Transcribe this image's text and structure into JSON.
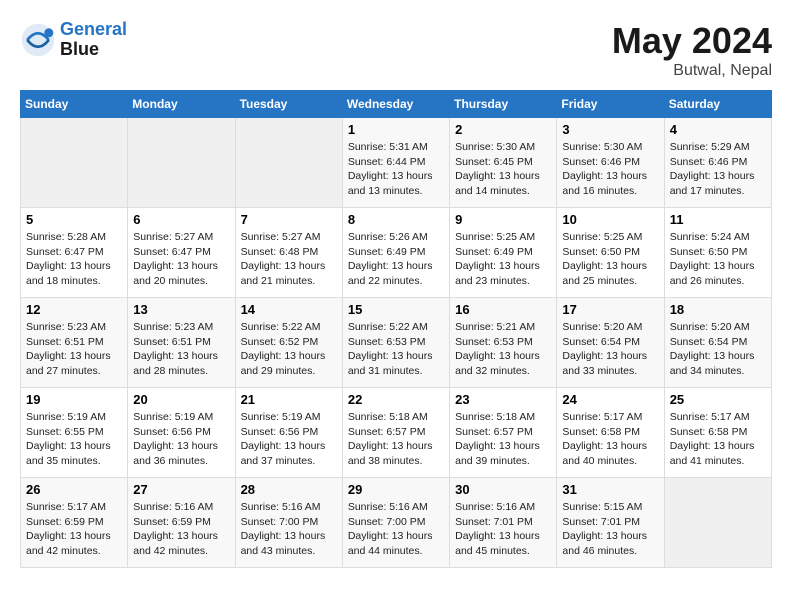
{
  "header": {
    "logo_line1": "General",
    "logo_line2": "Blue",
    "month_year": "May 2024",
    "location": "Butwal, Nepal"
  },
  "days_of_week": [
    "Sunday",
    "Monday",
    "Tuesday",
    "Wednesday",
    "Thursday",
    "Friday",
    "Saturday"
  ],
  "weeks": [
    [
      {
        "day": "",
        "info": ""
      },
      {
        "day": "",
        "info": ""
      },
      {
        "day": "",
        "info": ""
      },
      {
        "day": "1",
        "info": "Sunrise: 5:31 AM\nSunset: 6:44 PM\nDaylight: 13 hours\nand 13 minutes."
      },
      {
        "day": "2",
        "info": "Sunrise: 5:30 AM\nSunset: 6:45 PM\nDaylight: 13 hours\nand 14 minutes."
      },
      {
        "day": "3",
        "info": "Sunrise: 5:30 AM\nSunset: 6:46 PM\nDaylight: 13 hours\nand 16 minutes."
      },
      {
        "day": "4",
        "info": "Sunrise: 5:29 AM\nSunset: 6:46 PM\nDaylight: 13 hours\nand 17 minutes."
      }
    ],
    [
      {
        "day": "5",
        "info": "Sunrise: 5:28 AM\nSunset: 6:47 PM\nDaylight: 13 hours\nand 18 minutes."
      },
      {
        "day": "6",
        "info": "Sunrise: 5:27 AM\nSunset: 6:47 PM\nDaylight: 13 hours\nand 20 minutes."
      },
      {
        "day": "7",
        "info": "Sunrise: 5:27 AM\nSunset: 6:48 PM\nDaylight: 13 hours\nand 21 minutes."
      },
      {
        "day": "8",
        "info": "Sunrise: 5:26 AM\nSunset: 6:49 PM\nDaylight: 13 hours\nand 22 minutes."
      },
      {
        "day": "9",
        "info": "Sunrise: 5:25 AM\nSunset: 6:49 PM\nDaylight: 13 hours\nand 23 minutes."
      },
      {
        "day": "10",
        "info": "Sunrise: 5:25 AM\nSunset: 6:50 PM\nDaylight: 13 hours\nand 25 minutes."
      },
      {
        "day": "11",
        "info": "Sunrise: 5:24 AM\nSunset: 6:50 PM\nDaylight: 13 hours\nand 26 minutes."
      }
    ],
    [
      {
        "day": "12",
        "info": "Sunrise: 5:23 AM\nSunset: 6:51 PM\nDaylight: 13 hours\nand 27 minutes."
      },
      {
        "day": "13",
        "info": "Sunrise: 5:23 AM\nSunset: 6:51 PM\nDaylight: 13 hours\nand 28 minutes."
      },
      {
        "day": "14",
        "info": "Sunrise: 5:22 AM\nSunset: 6:52 PM\nDaylight: 13 hours\nand 29 minutes."
      },
      {
        "day": "15",
        "info": "Sunrise: 5:22 AM\nSunset: 6:53 PM\nDaylight: 13 hours\nand 31 minutes."
      },
      {
        "day": "16",
        "info": "Sunrise: 5:21 AM\nSunset: 6:53 PM\nDaylight: 13 hours\nand 32 minutes."
      },
      {
        "day": "17",
        "info": "Sunrise: 5:20 AM\nSunset: 6:54 PM\nDaylight: 13 hours\nand 33 minutes."
      },
      {
        "day": "18",
        "info": "Sunrise: 5:20 AM\nSunset: 6:54 PM\nDaylight: 13 hours\nand 34 minutes."
      }
    ],
    [
      {
        "day": "19",
        "info": "Sunrise: 5:19 AM\nSunset: 6:55 PM\nDaylight: 13 hours\nand 35 minutes."
      },
      {
        "day": "20",
        "info": "Sunrise: 5:19 AM\nSunset: 6:56 PM\nDaylight: 13 hours\nand 36 minutes."
      },
      {
        "day": "21",
        "info": "Sunrise: 5:19 AM\nSunset: 6:56 PM\nDaylight: 13 hours\nand 37 minutes."
      },
      {
        "day": "22",
        "info": "Sunrise: 5:18 AM\nSunset: 6:57 PM\nDaylight: 13 hours\nand 38 minutes."
      },
      {
        "day": "23",
        "info": "Sunrise: 5:18 AM\nSunset: 6:57 PM\nDaylight: 13 hours\nand 39 minutes."
      },
      {
        "day": "24",
        "info": "Sunrise: 5:17 AM\nSunset: 6:58 PM\nDaylight: 13 hours\nand 40 minutes."
      },
      {
        "day": "25",
        "info": "Sunrise: 5:17 AM\nSunset: 6:58 PM\nDaylight: 13 hours\nand 41 minutes."
      }
    ],
    [
      {
        "day": "26",
        "info": "Sunrise: 5:17 AM\nSunset: 6:59 PM\nDaylight: 13 hours\nand 42 minutes."
      },
      {
        "day": "27",
        "info": "Sunrise: 5:16 AM\nSunset: 6:59 PM\nDaylight: 13 hours\nand 42 minutes."
      },
      {
        "day": "28",
        "info": "Sunrise: 5:16 AM\nSunset: 7:00 PM\nDaylight: 13 hours\nand 43 minutes."
      },
      {
        "day": "29",
        "info": "Sunrise: 5:16 AM\nSunset: 7:00 PM\nDaylight: 13 hours\nand 44 minutes."
      },
      {
        "day": "30",
        "info": "Sunrise: 5:16 AM\nSunset: 7:01 PM\nDaylight: 13 hours\nand 45 minutes."
      },
      {
        "day": "31",
        "info": "Sunrise: 5:15 AM\nSunset: 7:01 PM\nDaylight: 13 hours\nand 46 minutes."
      },
      {
        "day": "",
        "info": ""
      }
    ]
  ]
}
